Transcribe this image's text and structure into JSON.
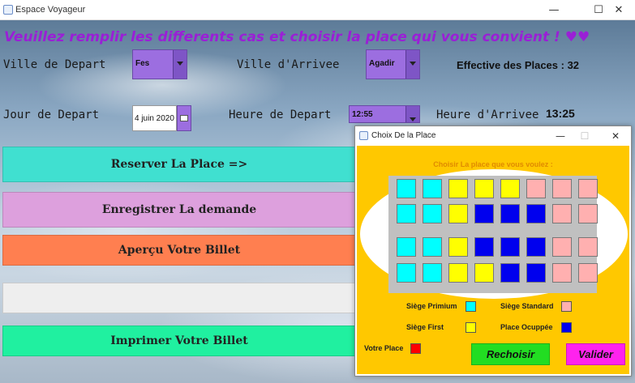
{
  "window": {
    "title": "Espace Voyageur",
    "minimize": "—",
    "maximize": "☐",
    "close": "✕"
  },
  "headline": "Veuillez remplir les differents cas et choisir la place qui vous convient ! ♥♥",
  "form": {
    "ville_depart_label": "Ville de Depart",
    "ville_depart_value": "Fes",
    "ville_arrivee_label": "Ville d'Arrivee",
    "ville_arrivee_value": "Agadir",
    "effective_places": "Effective des Places : 32",
    "jour_depart_label": "Jour de Depart",
    "jour_depart_value": "4 juin 2020",
    "heure_depart_label": "Heure de Depart",
    "heure_depart_value": "12:55",
    "heure_arrivee_label": "Heure d'Arrivee",
    "heure_arrivee_value": "13:25"
  },
  "buttons": {
    "reserver": "Reserver La Place =>",
    "enregistrer": "Enregistrer La demande",
    "apercu": "Aperçu Votre Billet",
    "imprimer": "Imprimer Votre Billet"
  },
  "colors": {
    "reserver": "#40e0d0",
    "enregistrer": "#dda0dd",
    "apercu": "#ff7f50",
    "blank": "#eeeeee",
    "imprimer": "#20f0a0",
    "combo": "#9c6ee0",
    "headline": "#9a1fd6",
    "dialog_bg": "#ffc800",
    "premium": "#00ffff",
    "first": "#ffff00",
    "standard": "#ffb0b0",
    "occupied": "#0000ee",
    "votre": "#ff0000",
    "rechoisir": "#22dd22",
    "valider": "#ff22ee"
  },
  "dialog": {
    "title": "Choix De la Place",
    "minimize": "—",
    "maximize": "☐",
    "close": "✕",
    "instruction": "Choisir La place que vous voulez :",
    "seat_rows": [
      [
        "premium",
        "premium",
        "first",
        "first",
        "first",
        "standard",
        "standard",
        "standard"
      ],
      [
        "premium",
        "premium",
        "first",
        "occupied",
        "occupied",
        "occupied",
        "standard",
        "standard"
      ],
      [
        "premium",
        "premium",
        "first",
        "occupied",
        "occupied",
        "occupied",
        "standard",
        "standard"
      ],
      [
        "premium",
        "premium",
        "first",
        "first",
        "occupied",
        "occupied",
        "standard",
        "standard"
      ]
    ],
    "legend": {
      "premium": "Siège Primium",
      "standard": "Siège Standard",
      "first": "Siège First",
      "occupied": "Place Ocuppée",
      "votre": "Votre Place"
    },
    "rechoisir": "Rechoisir",
    "valider": "Valider"
  }
}
